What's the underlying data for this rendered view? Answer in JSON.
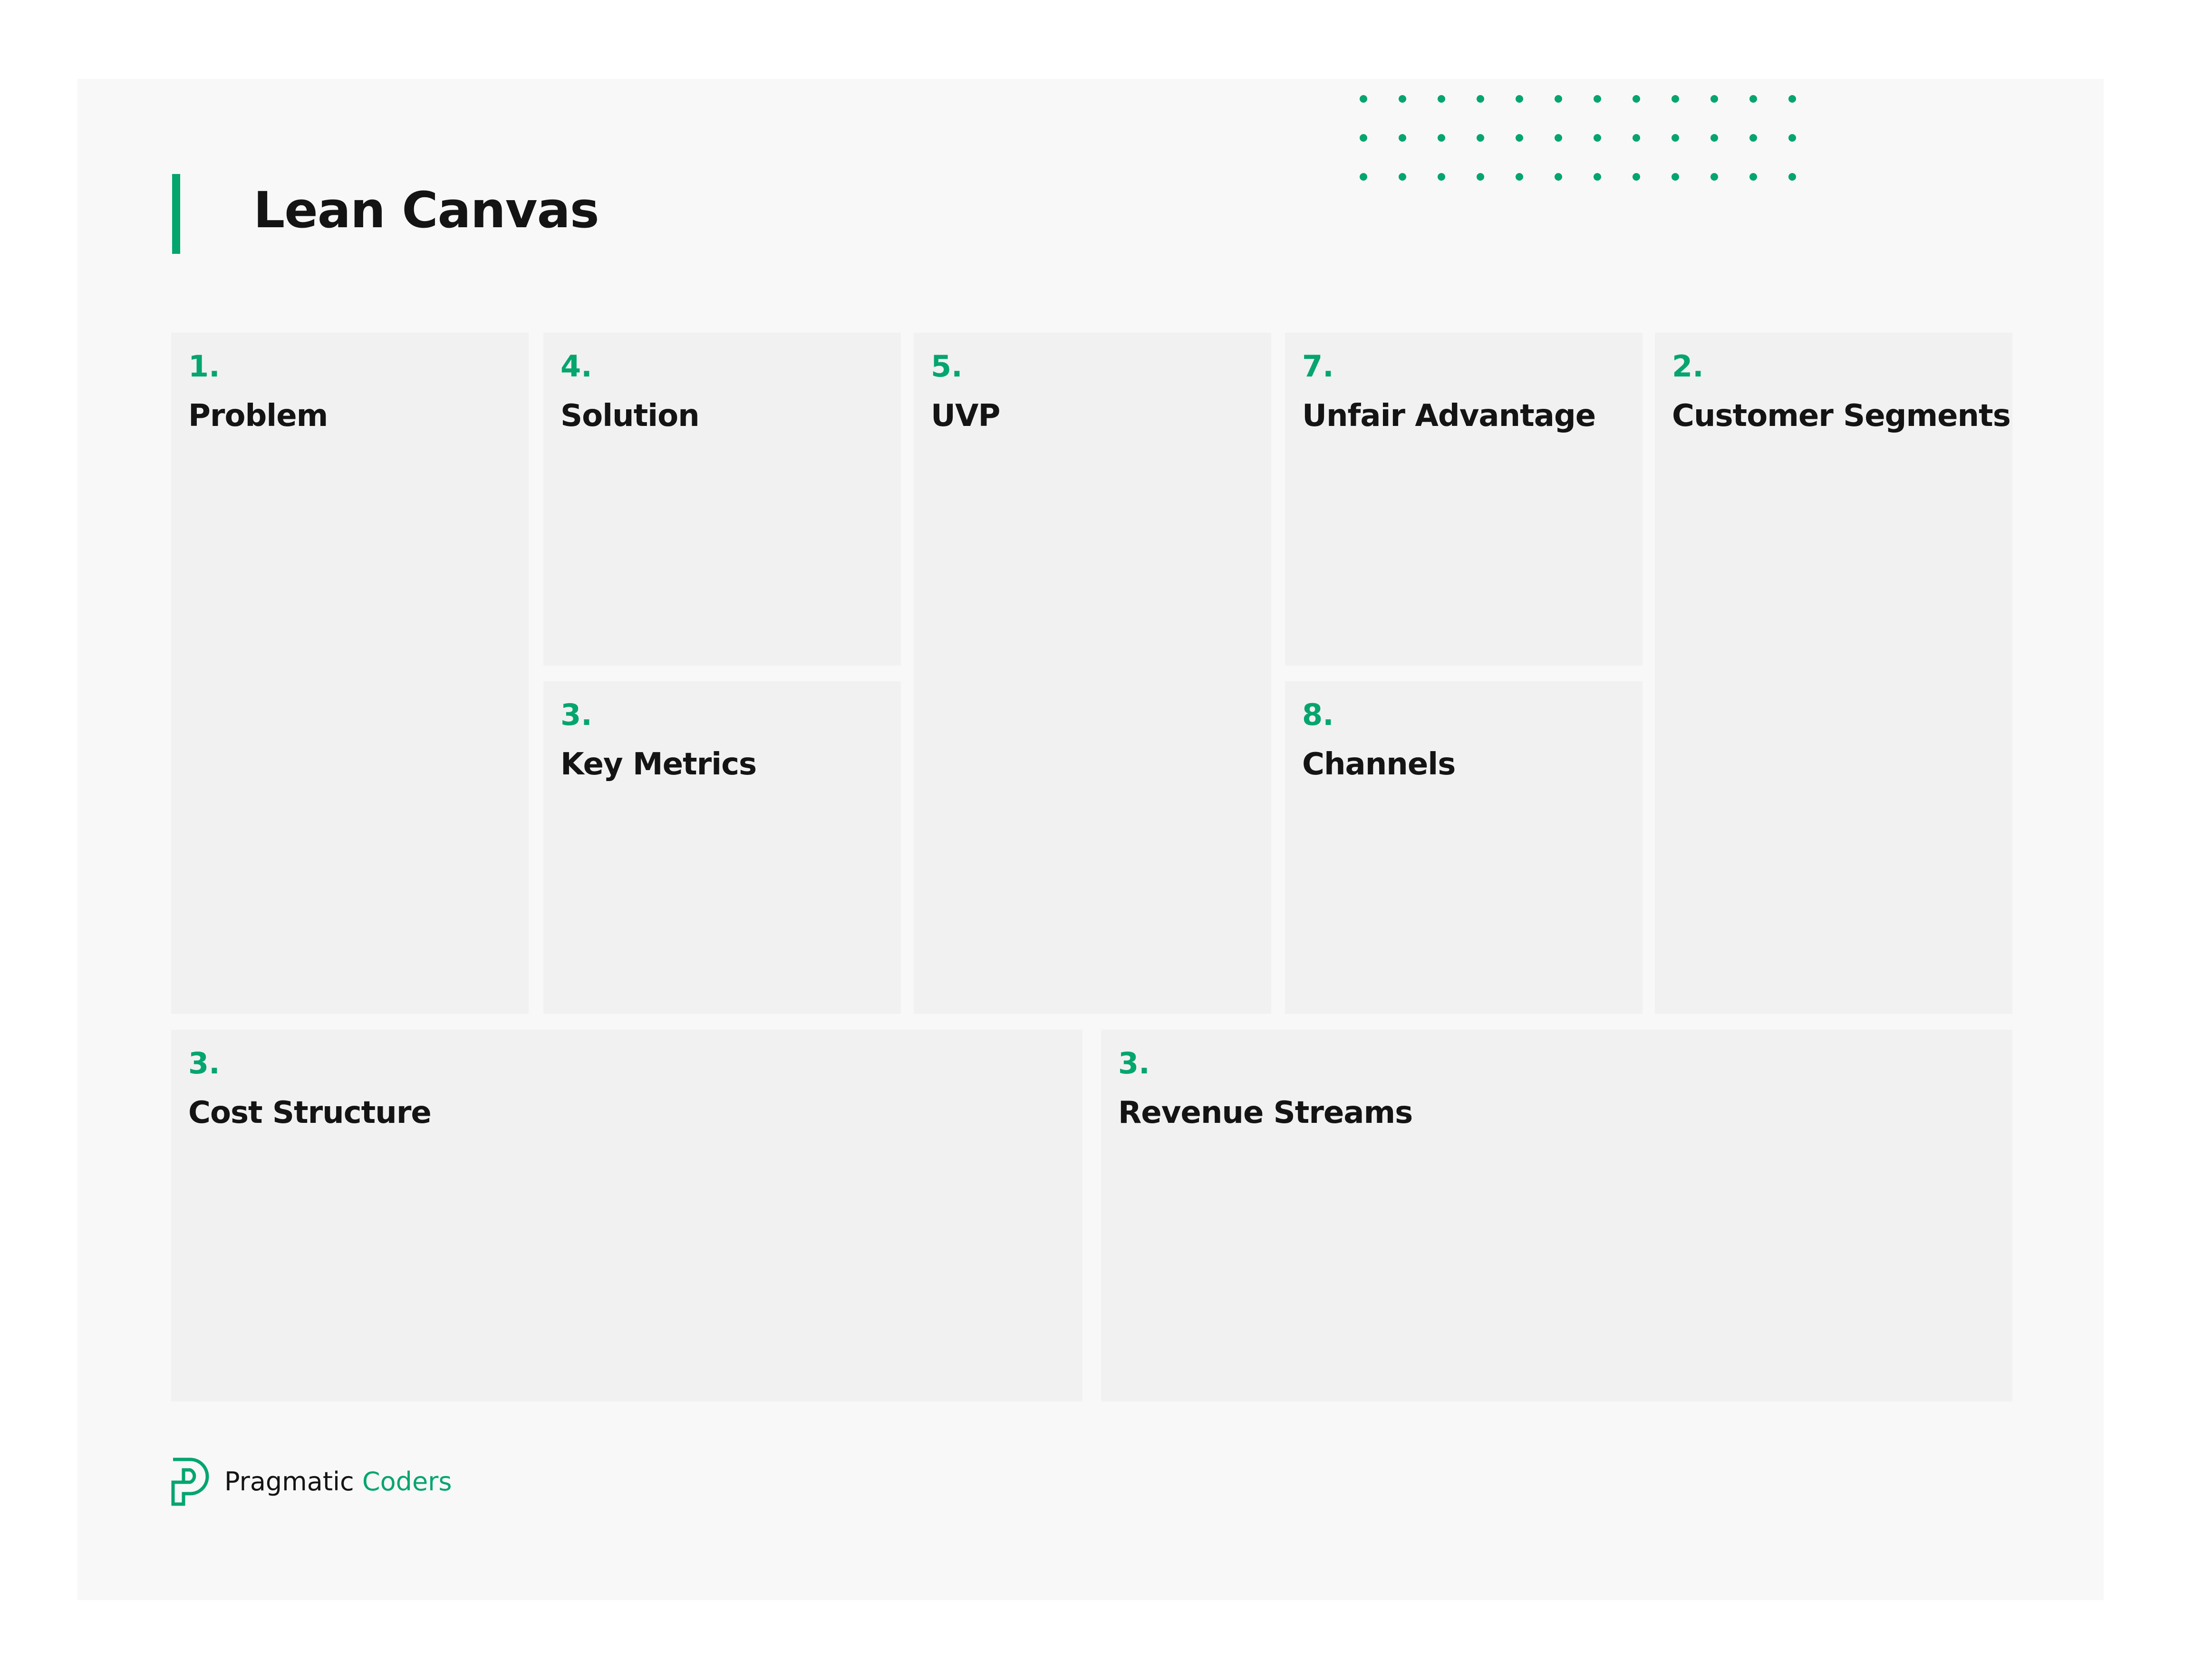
{
  "title": "Lean Canvas",
  "colors": {
    "accent": "#05a56e",
    "box_background": "#f1f1f1",
    "panel_background": "#f8f8f8",
    "text": "#141414"
  },
  "decoration": {
    "dot_grid_rows": 3,
    "dot_grid_columns": 12
  },
  "canvas": {
    "blocks": [
      {
        "id": "problem",
        "number": "1.",
        "label": "Problem"
      },
      {
        "id": "solution",
        "number": "4.",
        "label": "Solution"
      },
      {
        "id": "key-metrics",
        "number": "3.",
        "label": "Key Metrics"
      },
      {
        "id": "uvp",
        "number": "5.",
        "label": "UVP"
      },
      {
        "id": "unfair-advantage",
        "number": "7.",
        "label": "Unfair Advantage"
      },
      {
        "id": "channels",
        "number": "8.",
        "label": "Channels"
      },
      {
        "id": "customer-segments",
        "number": "2.",
        "label": "Customer Segments"
      },
      {
        "id": "cost-structure",
        "number": "3.",
        "label": "Cost Structure"
      },
      {
        "id": "revenue-streams",
        "number": "3.",
        "label": "Revenue Streams"
      }
    ]
  },
  "footer": {
    "logo_icon": "pragmatic-coders-p-logo",
    "brand_first": "Pragmatic",
    "brand_second": "Coders"
  }
}
